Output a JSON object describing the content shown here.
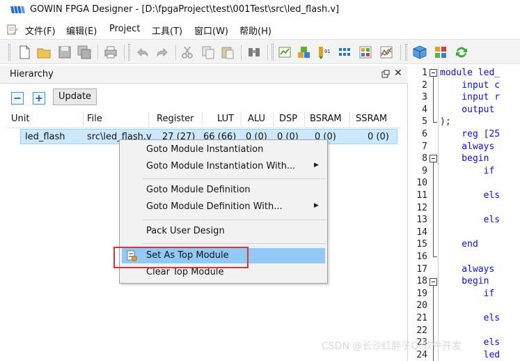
{
  "app": {
    "title": "GOWIN FPGA Designer - [D:\\fpgaProject\\test\\001Test\\src\\led_flash.v]",
    "logo": "gowin-logo-icon"
  },
  "menu": {
    "items": [
      "文件(F)",
      "编辑(E)",
      "Project",
      "工具(T)",
      "窗口(W)",
      "帮助(H)"
    ]
  },
  "toolbar": {
    "icons": [
      "new-file-icon",
      "open-folder-icon",
      "save-icon",
      "save-all-icon",
      "print-icon",
      "undo-icon",
      "redo-icon",
      "cut-icon",
      "copy-icon",
      "paste-icon",
      "find-icon",
      "synthesize-icon",
      "place-route-icon",
      "program-icon",
      "netlist-icon",
      "floorplan-icon",
      "timing-icon",
      "package-icon",
      "palette-icon",
      "refresh-icon"
    ]
  },
  "hierarchy": {
    "title": "Hierarchy",
    "update_label": "Update",
    "columns": [
      "Unit",
      "File",
      "Register",
      "LUT",
      "ALU",
      "DSP",
      "BSRAM",
      "SSRAM"
    ],
    "row": {
      "unit": "led_flash",
      "file": "src\\led_flash.v",
      "register": "27 (27)",
      "lut": "66 (66)",
      "alu": "0 (0)",
      "dsp": "0 (0)",
      "bsram": "0 (0)",
      "ssram": "0 (0)"
    }
  },
  "context_menu": {
    "goto_inst": "Goto Module Instantiation",
    "goto_inst_with": "Goto Module Instantiation With...",
    "goto_def": "Goto Module Definition",
    "goto_def_with": "Goto Module Definition With...",
    "pack": "Pack User Design",
    "set_top": "Set As Top Module",
    "clear_top": "Clear Top Module"
  },
  "editor": {
    "lines": [
      {
        "n": "1",
        "code": "module led_"
      },
      {
        "n": "2",
        "code": "    input c"
      },
      {
        "n": "3",
        "code": "    input r"
      },
      {
        "n": "4",
        "code": "    output"
      },
      {
        "n": "5",
        "code": ");"
      },
      {
        "n": "6",
        "code": "    reg [25"
      },
      {
        "n": "7",
        "code": "    always"
      },
      {
        "n": "8",
        "code": "    begin"
      },
      {
        "n": "9",
        "code": "        if"
      },
      {
        "n": "10",
        "code": ""
      },
      {
        "n": "11",
        "code": "        els"
      },
      {
        "n": "12",
        "code": ""
      },
      {
        "n": "13",
        "code": "        els"
      },
      {
        "n": "14",
        "code": ""
      },
      {
        "n": "15",
        "code": "    end"
      },
      {
        "n": "16",
        "code": ""
      },
      {
        "n": "17",
        "code": "    always"
      },
      {
        "n": "18",
        "code": "    begin"
      },
      {
        "n": "19",
        "code": "        if"
      },
      {
        "n": "20",
        "code": ""
      },
      {
        "n": "21",
        "code": "        els"
      },
      {
        "n": "22",
        "code": ""
      },
      {
        "n": "23",
        "code": "        els"
      },
      {
        "n": "24",
        "code": "        led"
      }
    ]
  },
  "watermark": "CSDN @长沙红胖子Qt软件开发"
}
